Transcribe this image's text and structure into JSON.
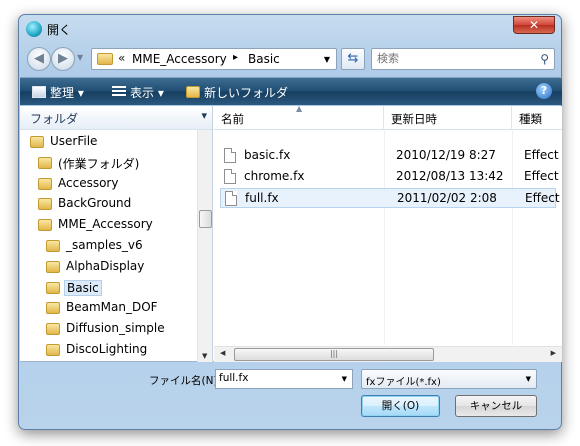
{
  "window": {
    "title": "開く",
    "close_glyph": "✕"
  },
  "address": {
    "back_glyph": "◀",
    "forward_glyph": "▶",
    "chevron": "«",
    "crumbs": [
      "MME_Accessory",
      "Basic"
    ],
    "separator": "▸"
  },
  "search": {
    "placeholder": "検索",
    "icon": "search-icon"
  },
  "toolbar": {
    "organize": "整理",
    "view": "表示",
    "new_folder": "新しいフォルダ",
    "help": "?"
  },
  "left_pane": {
    "header": "フォルダ",
    "items": [
      {
        "label": "UserFile",
        "level": 0
      },
      {
        "label": "(作業フォルダ)",
        "level": 1
      },
      {
        "label": "Accessory",
        "level": 1
      },
      {
        "label": "BackGround",
        "level": 1
      },
      {
        "label": "MME_Accessory",
        "level": 1
      },
      {
        "label": "_samples_v6",
        "level": 2
      },
      {
        "label": "AlphaDisplay",
        "level": 2
      },
      {
        "label": "Basic",
        "level": 2,
        "selected": true
      },
      {
        "label": "BeamMan_DOF",
        "level": 2
      },
      {
        "label": "Diffusion_simple",
        "level": 2
      },
      {
        "label": "DiscoLighting",
        "level": 2
      }
    ]
  },
  "file_list": {
    "columns": [
      "名前",
      "更新日時",
      "種類"
    ],
    "rows": [
      {
        "name": "basic.fx",
        "modified": "2010/12/19 8:27",
        "type": "Effect"
      },
      {
        "name": "chrome.fx",
        "modified": "2012/08/13 13:42",
        "type": "Effect"
      },
      {
        "name": "full.fx",
        "modified": "2011/02/02 2:08",
        "type": "Effect",
        "selected": true
      }
    ]
  },
  "bottom": {
    "filename_label": "ファイル名(N):",
    "filename_value": "full.fx",
    "filetype_value": "fxファイル(*.fx)",
    "open_button": "開く(O)",
    "cancel_button": "キャンセル"
  }
}
